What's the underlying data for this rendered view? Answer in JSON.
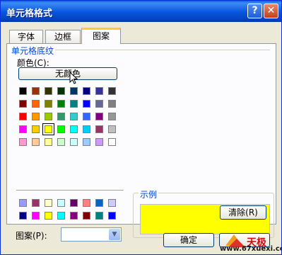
{
  "window": {
    "title": "单元格格式",
    "help_label": "?",
    "close_label": "✕"
  },
  "tabs": [
    {
      "label": "字体",
      "active": false
    },
    {
      "label": "边框",
      "active": false
    },
    {
      "label": "图案",
      "active": true
    }
  ],
  "shading_group": {
    "title": "单元格底纹",
    "color_label": "颜色(C):",
    "no_color_button": "无颜色"
  },
  "palette_main": [
    [
      "#000000",
      "#993300",
      "#333300",
      "#003300",
      "#003366",
      "#000080",
      "#333399",
      "#333333"
    ],
    [
      "#800000",
      "#ff6600",
      "#808000",
      "#008000",
      "#008080",
      "#0000ff",
      "#666699",
      "#808080"
    ],
    [
      "#ff0000",
      "#ff9900",
      "#99cc00",
      "#339966",
      "#33cccc",
      "#3366ff",
      "#800080",
      "#969696"
    ],
    [
      "#ff00ff",
      "#ffcc00",
      "#ffff00",
      "#00ff00",
      "#00ffff",
      "#00ccff",
      "#993366",
      "#c0c0c0"
    ],
    [
      "#ff99cc",
      "#ffcc99",
      "#ffff99",
      "#ccffcc",
      "#ccffff",
      "#99ccff",
      "#cc99ff",
      "#ffffff"
    ]
  ],
  "palette_extra": [
    [
      "#9999ff",
      "#993366",
      "#ffffcc",
      "#ccffff",
      "#660066",
      "#ff8080",
      "#0066cc",
      "#ccccff"
    ],
    [
      "#000080",
      "#ff00ff",
      "#ffff00",
      "#00ffff",
      "#800080",
      "#800000",
      "#008080",
      "#0000ff"
    ]
  ],
  "selected_color": "#ffff00",
  "pattern": {
    "label": "图案(P):",
    "value": ""
  },
  "sample": {
    "label": "示例",
    "color": "#ffff00"
  },
  "clear_button": "清除(R)",
  "ok_button": "确定",
  "watermark": {
    "brand": "天极",
    "url": "www.67xuexi.com"
  }
}
